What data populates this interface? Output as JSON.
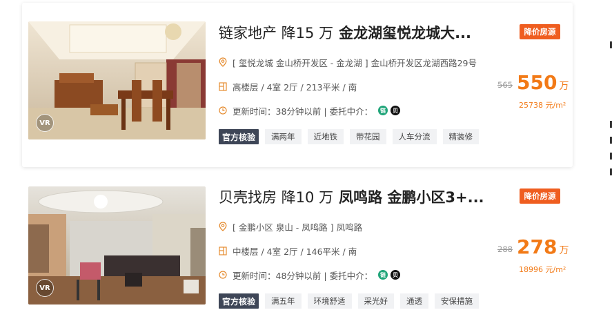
{
  "listings": [
    {
      "title_prefix": "链家地产 降15 万",
      "title_bold": "金龙湖玺悦龙城大...",
      "badge": "降价房源",
      "location": "[ 玺悦龙城 金山桥开发区 - 金龙湖 ] 金山桥开发区龙湖西路29号",
      "info": "高楼层 / 4室 2厅 / 213平米 / 南",
      "update": "更新时间：38分钟以前 | 委托中介：",
      "agent_a": "链",
      "agent_b": "贝",
      "official_tag": "官方核验",
      "tags": [
        "满两年",
        "近地铁",
        "带花园",
        "人车分流",
        "精装修"
      ],
      "old_price": "565",
      "price": "550",
      "price_unit": "万",
      "unit_price": "25738 元/m²",
      "vr_label": "VR"
    },
    {
      "title_prefix": "贝壳找房 降10 万",
      "title_bold": "凤鸣路 金鹏小区3+...",
      "badge": "降价房源",
      "location": "[ 金鹏小区 泉山 - 凤鸣路 ] 凤鸣路",
      "info": "中楼层 / 4室 2厅 / 146平米 / 南",
      "update": "更新时间：48分钟以前 | 委托中介：",
      "agent_a": "链",
      "agent_b": "贝",
      "official_tag": "官方核验",
      "tags": [
        "满五年",
        "环境舒适",
        "采光好",
        "通透",
        "安保措施"
      ],
      "old_price": "288",
      "price": "278",
      "price_unit": "万",
      "unit_price": "18996 元/m²",
      "vr_label": "VR"
    }
  ],
  "colors": {
    "accent": "#ef5d1f",
    "price": "#f27a17",
    "official_tag_bg": "#3e4657",
    "tag_bg": "#f1f2f4"
  }
}
